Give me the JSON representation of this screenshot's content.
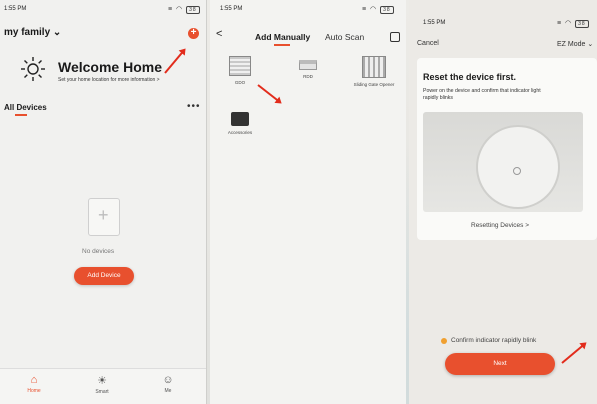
{
  "panel1": {
    "status_time": "1:55 PM",
    "family_label": "my family ⌄",
    "add_symbol": "+",
    "welcome_title": "Welcome Home",
    "welcome_sub": "Set your home location for more information >",
    "all_devices": "All Devices",
    "more": "•••",
    "no_devices": "No devices",
    "add_device": "Add Device",
    "tabs": [
      {
        "label": "Home",
        "icon": "home-icon",
        "glyph": "⌂"
      },
      {
        "label": "Smart",
        "icon": "smart-icon",
        "glyph": "☀"
      },
      {
        "label": "Me",
        "icon": "me-icon",
        "glyph": "☺"
      }
    ]
  },
  "panel2": {
    "status_time": "1:55 PM",
    "back": "<",
    "tab_manual": "Add Manually",
    "tab_scan": "Auto Scan",
    "categories": [
      {
        "label": "GDO"
      },
      {
        "label": "RDD"
      },
      {
        "label": "Sliding Gate Opener"
      },
      {
        "label": "Accessories"
      }
    ]
  },
  "panel3": {
    "status_time": "1:55 PM",
    "cancel": "Cancel",
    "ez_mode": "EZ Mode ⌄",
    "reset_title": "Reset the device first.",
    "reset_desc": "Power on the device and confirm that indicator light rapidly blinks",
    "resetting": "Resetting Devices >",
    "confirm": "Confirm indicator rapidly blink",
    "next": "Next"
  },
  "colors": {
    "accent": "#e8502e",
    "arrow": "#e22c1c"
  }
}
